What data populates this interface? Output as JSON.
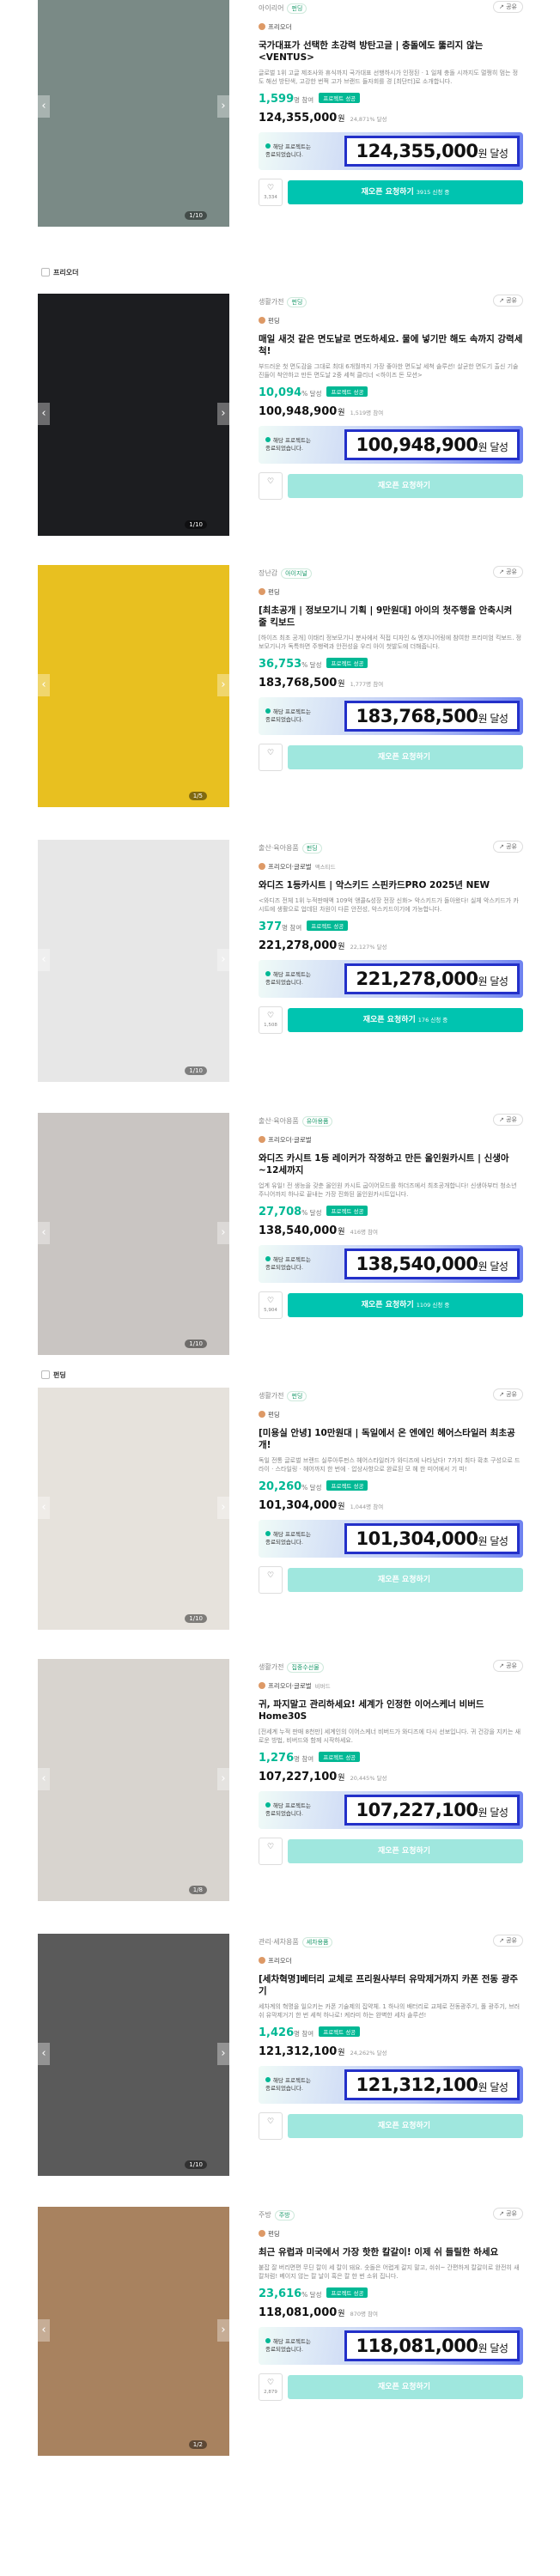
{
  "labels": {
    "share": "공유",
    "reopen_note": "재오픈 요청하기",
    "goal_suffix": "원 달성",
    "attain_suffix": "% 달성",
    "won": "원",
    "progress_note_line1": "해당 프로젝트는",
    "progress_note_line2": "종료되었습니다.",
    "success_tag": "프로젝트 성공",
    "heart_icon": "♡",
    "share_icon": "↗"
  },
  "section_labels": [
    {
      "text": "프리오더"
    },
    {
      "text": "펀딩"
    }
  ],
  "cards": [
    {
      "category": "아이리어",
      "badge": "펀딩",
      "maker": "프리오더",
      "maker_sub": "",
      "title": "국가대표가 선택한 초강력 방탄고글 | 충돌에도 뚫리지 않는 <VENTUS>",
      "desc": "글로벌 1위 고글 제조사와 휴식까지 국가대표 선행하시가 인정된 · 1 일체 충돌 시까지도 멀쩡히 멈는 정도 해선 방탄색, 고강한 번쩍 고가 브랜드 들자회를 경 [최단터]로 소개합니다.",
      "metric_value": "1,599",
      "metric_unit": "명 참여",
      "amount": "124,355,000",
      "amount_sub": "24,871% 달성",
      "goal": "124,355,000",
      "likes": "3,334",
      "reopen_sub": "3915 신청 중",
      "counter": "1/10",
      "photo_color": "#7a8a86"
    },
    {
      "category": "생활가전",
      "badge": "펀딩",
      "maker": "펀딩",
      "maker_sub": "",
      "title": "매일 새것 같은 면도날로 면도하세요. 물에 넣기만 해도 속까지 강력세척!",
      "desc": "부드러운 첫 면도감을 그대로 최대 6개월까지 가장 좋아한 면도날 세척 솔루션! 살균한 면도기 출신 기술진들이 착안하고 만든 면도날 2중 세척 클리너 <하이즈 돈 모션>",
      "metric_value": "10,094",
      "metric_unit": "% 달성",
      "amount": "100,948,900",
      "amount_sub": "1,519명 참여",
      "goal": "100,948,900",
      "likes": "",
      "reopen_sub": "",
      "counter": "1/10",
      "photo_color": "#1c1d20"
    },
    {
      "category": "장난감",
      "badge": "아이지널",
      "maker": "펀딩",
      "maker_sub": "",
      "title": "[최초공개 | 정보모기니 기획 | 9만원대] 아이의 첫주행을 안축시켜 줄 킥보드",
      "desc": "[하이즈 최초 공개] 이태리 정보모기니 분사에서 직접 디자인 & 엔지니어링에 참여한 프리미엄 킥보드. 정보모기니가 독특하면 주행력과 안전성을 우리 아이 첫발도에 더해줍니다.",
      "metric_value": "36,753",
      "metric_unit": "% 달성",
      "amount": "183,768,500",
      "amount_sub": "1,777명 참여",
      "goal": "183,768,500",
      "likes": "",
      "reopen_sub": "",
      "counter": "1/5",
      "photo_color": "#e8c020"
    },
    {
      "category": "출산·육아용품",
      "badge": "펀딩",
      "maker": "프리오더·글로벌",
      "maker_sub": "액스티드",
      "title": "와디즈 1등카시트 | 악스키드 스핀카드PRO 2025년 NEW",
      "desc": "<와디즈 전체 1위 누적판매액 109억 앵콜&성장 전장 신화> 악스키드가 돌아왔다! 실체 악스키드가 카시트에 생활으로 업데된 차원이 다른 안전성, 악스키드이기에 가능합니다.",
      "metric_value": "377",
      "metric_unit": "명 참여",
      "amount": "221,278,000",
      "amount_sub": "22,127% 달성",
      "goal": "221,278,000",
      "likes": "1,508",
      "reopen_sub": "176 신청 중",
      "counter": "1/10",
      "photo_color": "#e7e7e7"
    },
    {
      "category": "출산·육아용품",
      "badge": "유아용품",
      "maker": "프리오더·글로벌",
      "maker_sub": "",
      "title": "와디즈 카시트 1등 레이커가 작정하고 만든 올인원카시트 | 신생아~12세까지",
      "desc": "업계 유일! 전 생능을 갖춘 올인원 카시트 굽이어모드를 하더즈에서 최초공개합니다! 신생아부터 청소년 주니어까지 하나로 끝내는 가장 진화된 올인원카시트입니다.",
      "metric_value": "27,708",
      "metric_unit": "% 달성",
      "amount": "138,540,000",
      "amount_sub": "416명 참여",
      "goal": "138,540,000",
      "likes": "5,904",
      "reopen_sub": "1109 신청 중",
      "counter": "1/10",
      "photo_color": "#c9c5c2"
    },
    {
      "category": "생활가전",
      "badge": "펀딩",
      "maker": "펀딩",
      "maker_sub": "",
      "title": "[미용실 안녕] 10만원대 | 독일에서 온 엔에인 헤어스타일러 최초공개!",
      "desc": "독일 전통 글로벌 브랜드 실루아투펀스 헤어스타일러가 와디즈에 나타났다! 7가지 최다 확초 구성으로 드라이 · 스타일링 · 헤어까지 한 번에 · 압상사항으로 완료된 모 헤 한 미어에서 기 피!",
      "metric_value": "20,260",
      "metric_unit": "% 달성",
      "amount": "101,304,000",
      "amount_sub": "1,044명 참여",
      "goal": "101,304,000",
      "likes": "",
      "reopen_sub": "",
      "counter": "1/10",
      "photo_color": "#e6e2dc"
    },
    {
      "category": "생활가전",
      "badge": "집중수선물",
      "maker": "프리오더·글로벌",
      "maker_sub": "비버드",
      "title": "귀, 파지말고 관리하세요! 세계가 인정한 이어스케너 비버드 Home30S",
      "desc": "[전세계 누적 판매 8천만] 세계인의 이어스케너 비버드가 와디즈에 다시 선보입니다. 귀 건강을 지키는 새로운 방법, 비버드와 함께 시작하세요.",
      "metric_value": "1,276",
      "metric_unit": "명 참여",
      "amount": "107,227,100",
      "amount_sub": "20,445% 달성",
      "goal": "107,227,100",
      "likes": "",
      "reopen_sub": "",
      "counter": "1/8",
      "photo_color": "#d8d4cf"
    },
    {
      "category": "관리·세차용품",
      "badge": "세차용품",
      "maker": "프리오더",
      "maker_sub": "",
      "title": "[세차혁명]베터리 교체로 프리원사부터 유막제거까지 카폰 전동 광주기",
      "desc": "세차계의 혁명을 일으키는 카폰 기술제의 집약체. 1 하나의 배터리로 교체로 전동광주기, 폴 광주기, 브러쉬 유막제거기 한 번 세척 하나로! 케라미 하는 완벽한 세차 솔루션!",
      "metric_value": "1,426",
      "metric_unit": "명 참여",
      "amount": "121,312,100",
      "amount_sub": "24,262% 달성",
      "goal": "121,312,100",
      "likes": "",
      "reopen_sub": "",
      "counter": "1/10",
      "photo_color": "#5a5a5a"
    },
    {
      "category": "주방",
      "badge": "주방",
      "maker": "펀딩",
      "maker_sub": "",
      "title": "최근 유럽과 미국에서 가장 핫한 칼갈이! 이제 쉬 들릴한 하세요",
      "desc": "붙잡 잘 버리면편 무딘 칼이 세 칼이 돼요. 숫돌은 어렵게 갈지 말고, 쉬쉬~ 간편하게 칼갈이로 완전히 새 칼처럼! 베이지 않는 칼 날이 혹은 칼 한 번 소위 집니다.",
      "metric_value": "23,616",
      "metric_unit": "% 달성",
      "amount": "118,081,000",
      "amount_sub": "870명 참여",
      "goal": "118,081,000",
      "likes": "2,879",
      "reopen_sub": "",
      "counter": "1/2",
      "photo_color": "#a8825f"
    }
  ]
}
